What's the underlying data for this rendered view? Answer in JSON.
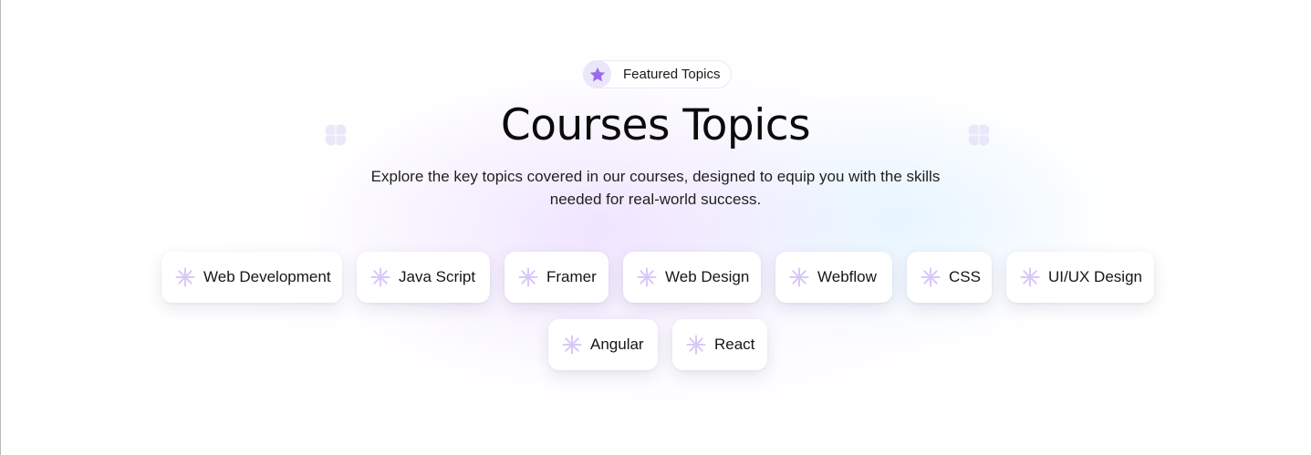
{
  "badge": {
    "icon": "star-icon",
    "label": "Featured Topics"
  },
  "heading": {
    "title": "Courses Topics",
    "subtitle_line1": "Explore the key topics covered in our courses, designed to equip you with the skills",
    "subtitle_line2": "needed for real-world success."
  },
  "topics": [
    {
      "label": "Web Development",
      "icon": "asterisk-icon"
    },
    {
      "label": "Java Script",
      "icon": "asterisk-icon"
    },
    {
      "label": "Framer",
      "icon": "asterisk-icon"
    },
    {
      "label": "Web Design",
      "icon": "asterisk-icon"
    },
    {
      "label": "Webflow",
      "icon": "asterisk-icon"
    },
    {
      "label": "CSS",
      "icon": "asterisk-icon"
    },
    {
      "label": "UI/UX Design",
      "icon": "asterisk-icon"
    },
    {
      "label": "Angular",
      "icon": "asterisk-icon"
    },
    {
      "label": "React",
      "icon": "asterisk-icon"
    }
  ],
  "decorations": [
    "clover-icon",
    "clover-icon"
  ],
  "colors": {
    "accent": "#9a6be8",
    "accent_soft": "#ece6fb",
    "chip_icon": "#d7c8f7",
    "deco": "#ddd6f6",
    "text": "#111111"
  }
}
